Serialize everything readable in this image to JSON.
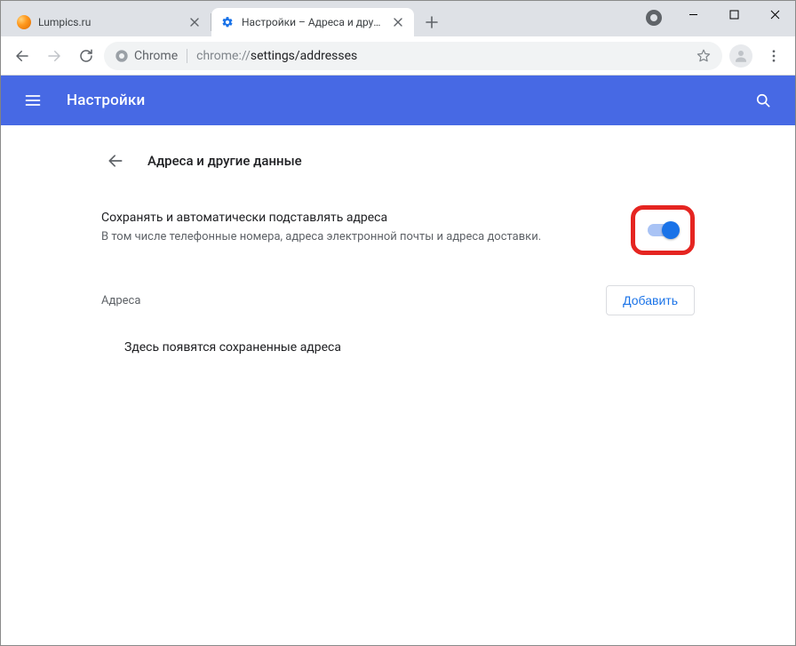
{
  "window": {
    "tabs": [
      {
        "title": "Lumpics.ru"
      },
      {
        "title": "Настройки – Адреса и другие д"
      }
    ]
  },
  "omnibox": {
    "chip_label": "Chrome",
    "url_prefix": "chrome://",
    "url_path": "settings/addresses"
  },
  "settings_header": {
    "title": "Настройки"
  },
  "page": {
    "section_title": "Адреса и другие данные",
    "autofill": {
      "primary": "Сохранять и автоматически подставлять адреса",
      "secondary": "В том числе телефонные номера, адреса электронной почты и адреса доставки."
    },
    "addresses_label": "Адреса",
    "add_button": "Добавить",
    "empty_message": "Здесь появятся сохраненные адреса"
  }
}
